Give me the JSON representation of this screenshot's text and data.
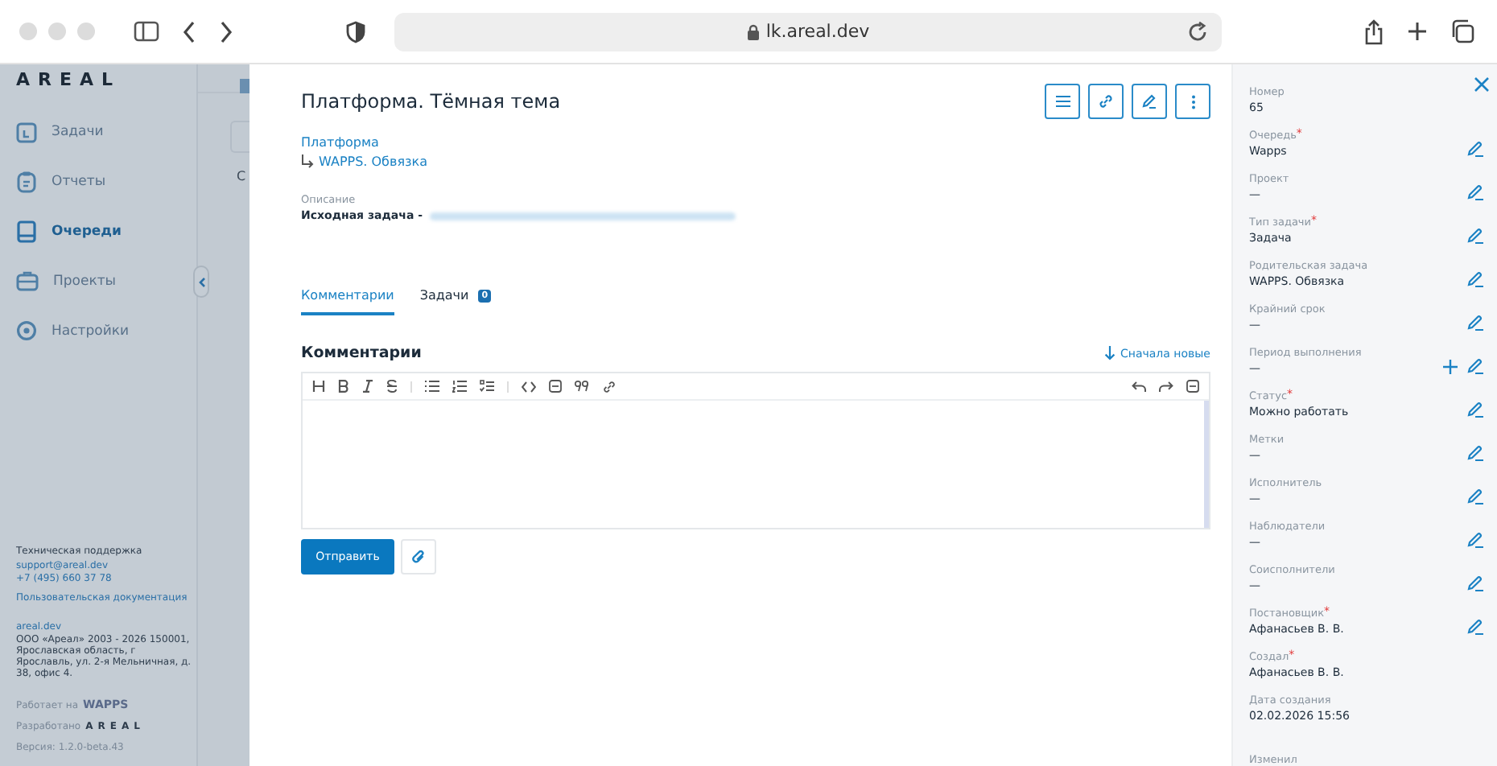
{
  "browser": {
    "url": "lk.areal.dev"
  },
  "sidebar": {
    "logo": "AREAL",
    "items": [
      {
        "label": "Задачи",
        "kind": "task",
        "selected": false
      },
      {
        "label": "Отчеты",
        "kind": "report",
        "selected": false
      },
      {
        "label": "Очереди",
        "kind": "queue",
        "selected": true
      },
      {
        "label": "Проекты",
        "kind": "project",
        "selected": false
      },
      {
        "label": "Настройки",
        "kind": "settings",
        "selected": false
      }
    ],
    "support_title": "Техническая поддержка",
    "support_email": "support@areal.dev",
    "support_phone": "+7 (495) 660 37 78",
    "docs_link": "Пользовательская документация",
    "site_link": "areal.dev",
    "company": "ООО «Ареал» 2003 - 2026 150001, Ярославская область, г Ярославль, ул. 2-я Мельничная, д. 38, офис 4.",
    "powered_label": "Работает на",
    "powered_brand": "WAPPS",
    "developed_label": "Разработано",
    "developed_brand": "AREAL",
    "version": "Версия: 1.2.0-beta.43"
  },
  "background_page": {
    "heading_fragment": "С"
  },
  "task": {
    "title": "Платформа. Тёмная тема",
    "project_link": "Платформа",
    "parent_link": "WAPPS. Обвязка",
    "description_label": "Описание",
    "description_text": "Исходная задача -",
    "tabs": [
      {
        "label": "Комментарии",
        "selected": true
      },
      {
        "label": "Задачи",
        "selected": false,
        "count": "0"
      }
    ],
    "comments_heading": "Комментарии",
    "sort_link": "Сначала новые",
    "send_button": "Отправить"
  },
  "details": [
    {
      "label": "Номер",
      "value": "65",
      "editable": false,
      "addable": false
    },
    {
      "label": "Очередь",
      "required_mark": "*",
      "value": "Wapps",
      "editable": true,
      "addable": false
    },
    {
      "label": "Проект",
      "value": "—",
      "editable": true,
      "addable": false
    },
    {
      "label": "Тип задачи",
      "required_mark": "*",
      "value": "Задача",
      "editable": true,
      "addable": false
    },
    {
      "label": "Родительская задача",
      "value": "WAPPS. Обвязка",
      "editable": true,
      "addable": false
    },
    {
      "label": "Крайний срок",
      "value": "—",
      "editable": true,
      "addable": false
    },
    {
      "label": "Период выполнения",
      "value": "—",
      "editable": true,
      "addable": true
    },
    {
      "label": "Статус",
      "required_mark": "*",
      "value": "Можно работать",
      "editable": true,
      "addable": false
    },
    {
      "label": "Метки",
      "value": "—",
      "editable": true,
      "addable": false
    },
    {
      "label": "Исполнитель",
      "value": "—",
      "editable": true,
      "addable": false
    },
    {
      "label": "Наблюдатели",
      "value": "—",
      "editable": true,
      "addable": false
    },
    {
      "label": "Соисполнители",
      "value": "—",
      "editable": true,
      "addable": false
    },
    {
      "label": "Постановщик",
      "required_mark": "*",
      "value": "Афанасьев В. В.",
      "editable": true,
      "addable": false
    },
    {
      "label": "Создал",
      "required_mark": "*",
      "value": "Афанасьев В. В.",
      "editable": false,
      "addable": false
    },
    {
      "label": "Дата создания",
      "value": "02.02.2026 15:56",
      "editable": false,
      "addable": false
    },
    {
      "label": "Изменил",
      "editable": false,
      "addable": false
    }
  ]
}
